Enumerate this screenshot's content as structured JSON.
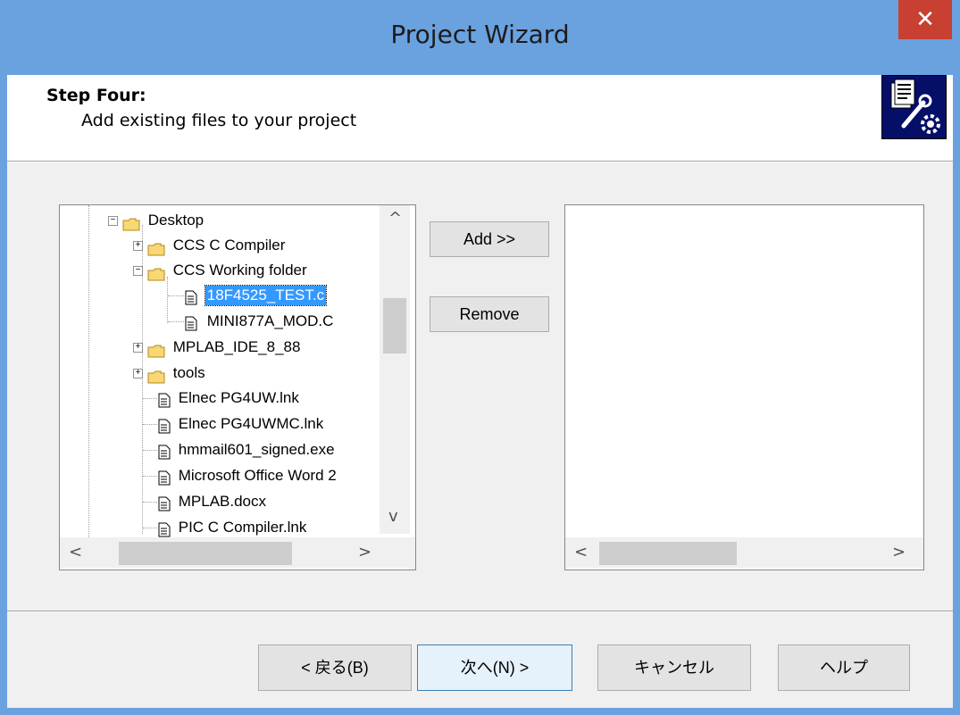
{
  "window": {
    "title": "Project Wizard",
    "close_glyph": "✕"
  },
  "header": {
    "step_title": "Step Four:",
    "step_subtitle": "Add existing files to your project",
    "icon": "wizard-tools-icon"
  },
  "tree": {
    "items": [
      {
        "label": "Desktop",
        "kind": "folder",
        "expander": "−"
      },
      {
        "label": "CCS C Compiler",
        "kind": "folder",
        "expander": "+"
      },
      {
        "label": "CCS Working folder",
        "kind": "folder",
        "expander": "−"
      },
      {
        "label": "18F4525_TEST.c",
        "kind": "file",
        "selected": true
      },
      {
        "label": "MINI877A_MOD.C",
        "kind": "file"
      },
      {
        "label": "MPLAB_IDE_8_88",
        "kind": "folder",
        "expander": "+"
      },
      {
        "label": "tools",
        "kind": "folder",
        "expander": "+"
      },
      {
        "label": "Elnec PG4UW.lnk",
        "kind": "file"
      },
      {
        "label": "Elnec PG4UWMC.lnk",
        "kind": "file"
      },
      {
        "label": "hmmail601_signed.exe",
        "kind": "file"
      },
      {
        "label": "Microsoft Office Word 2",
        "kind": "file"
      },
      {
        "label": "MPLAB.docx",
        "kind": "file"
      },
      {
        "label": "PIC C Compiler.lnk",
        "kind": "file"
      }
    ],
    "arrows": {
      "up": "^",
      "down": "v",
      "left": "<",
      "right": ">"
    }
  },
  "buttons": {
    "add": "Add >>",
    "remove": "Remove",
    "back": "< 戻る(B)",
    "next": "次へ(N) >",
    "cancel": "キャンセル",
    "help": "ヘルプ"
  },
  "colors": {
    "titlebar": "#6aa2e0",
    "close": "#c84031",
    "selection": "#3399ff",
    "icon_bg": "#050f68"
  }
}
